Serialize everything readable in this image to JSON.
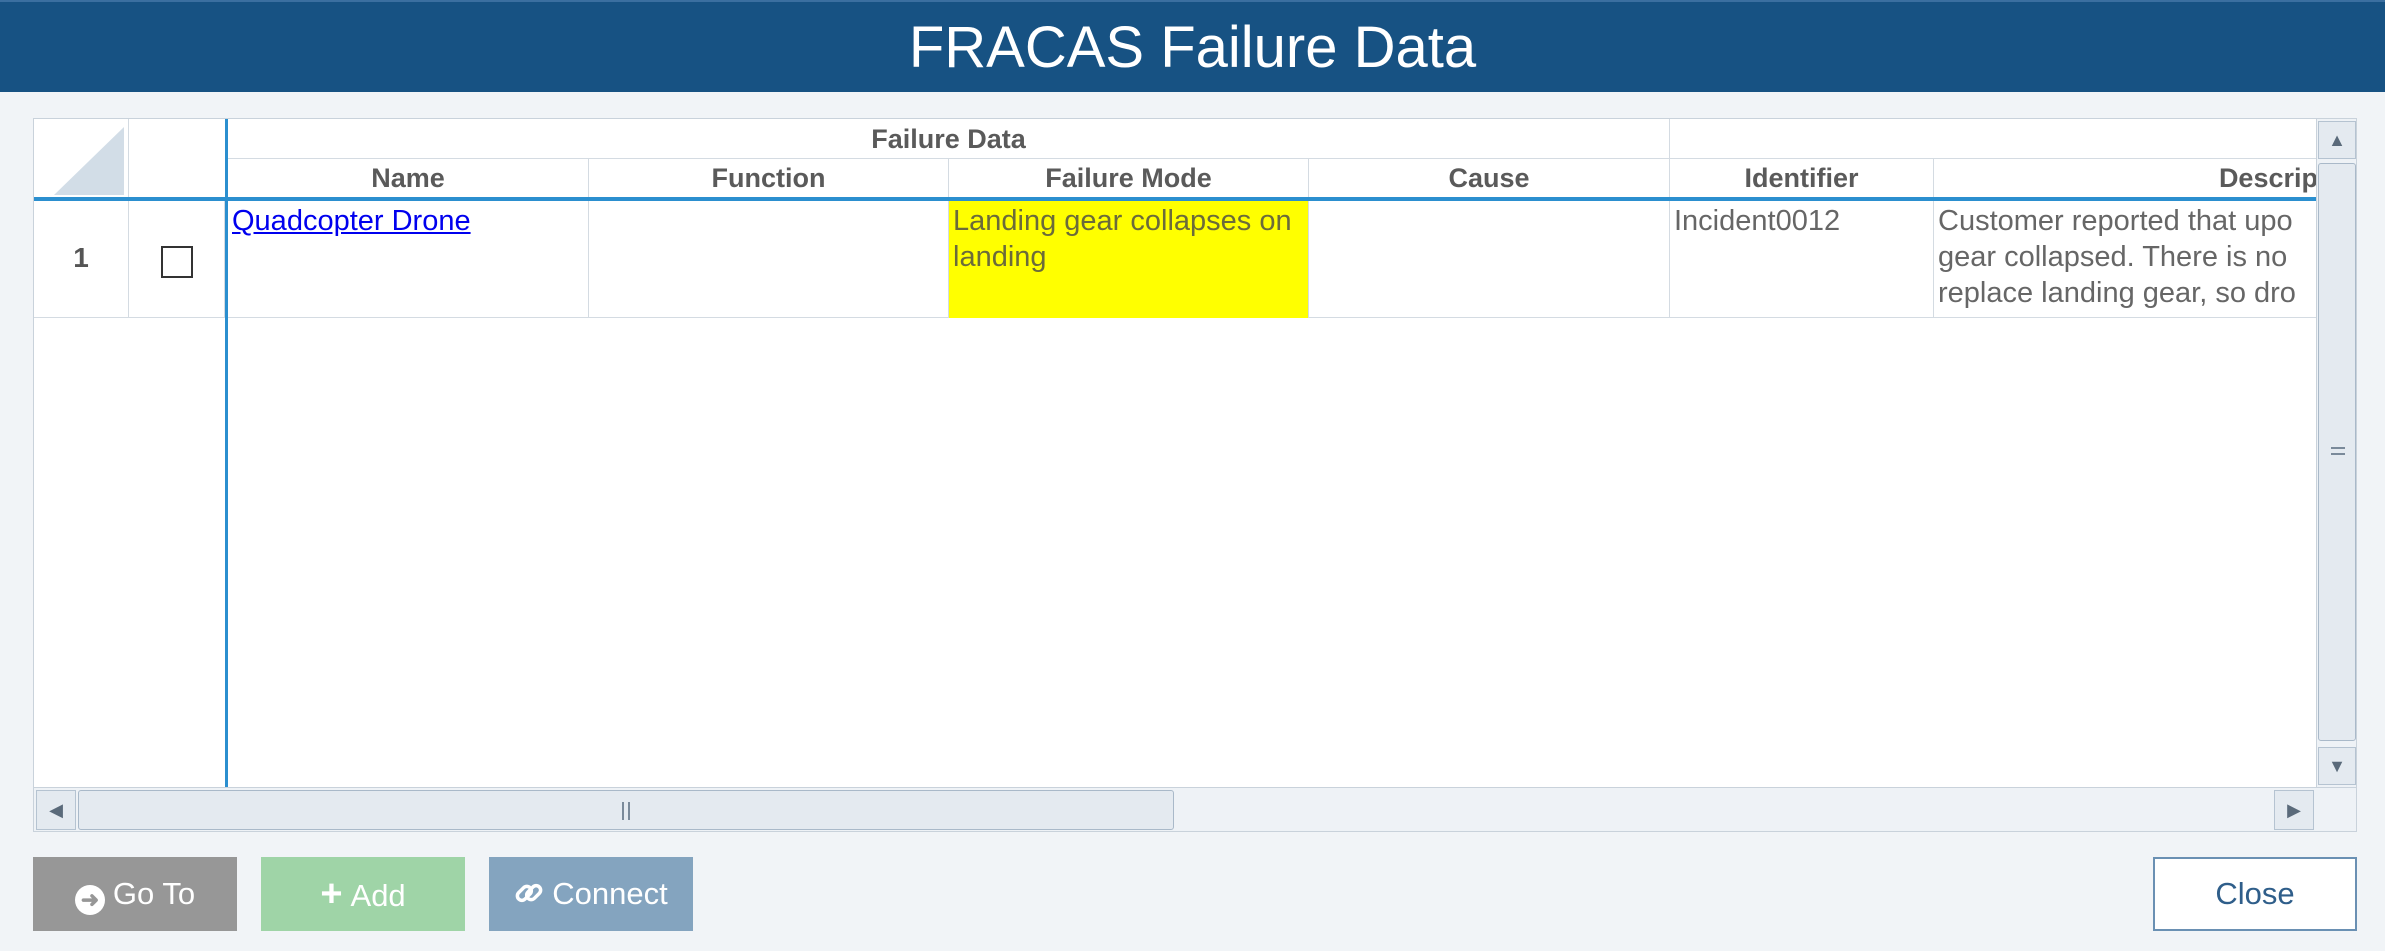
{
  "window": {
    "title": "FRACAS Failure Data"
  },
  "grid": {
    "group_header": "Failure Data",
    "columns": [
      "Name",
      "Function",
      "Failure Mode",
      "Cause",
      "Identifier",
      "Descrip"
    ],
    "rows": [
      {
        "number": "1",
        "name": "Quadcopter Drone",
        "function": "",
        "failure_mode": "Landing gear collapses on landing",
        "cause": "",
        "identifier": "Incident0012",
        "description_lines": [
          "Customer reported that upo",
          "gear collapsed. There is no",
          "replace landing gear, so dro"
        ]
      }
    ]
  },
  "buttons": {
    "goto": "Go To",
    "add": "Add",
    "connect": "Connect",
    "close": "Close"
  },
  "colors": {
    "titlebar": "#175283",
    "highlight": "#ffff00",
    "accent_line": "#2b8fcf"
  },
  "icons": {
    "goto": "arrow-circle-right-icon",
    "add": "plus-icon",
    "connect": "link-icon"
  }
}
